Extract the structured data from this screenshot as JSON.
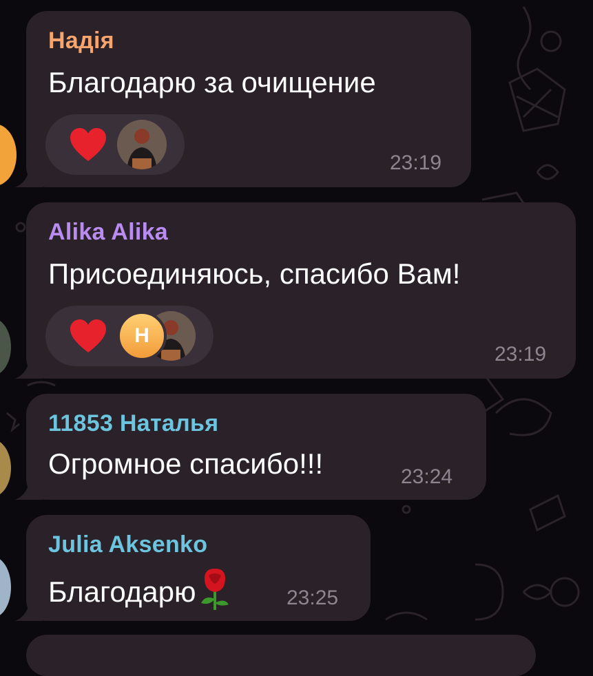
{
  "messages": [
    {
      "sender": "Надія",
      "sender_color": "#f5a56d",
      "text": "Благодарю за очищение",
      "time": "23:19",
      "reactions": {
        "emoji": "heart",
        "avatars": [
          "photo"
        ]
      }
    },
    {
      "sender": "Alika Alika",
      "sender_color": "#b88cf0",
      "text": "Присоединяюсь, спасибо Вам!",
      "time": "23:19",
      "reactions": {
        "emoji": "heart",
        "avatars": [
          "Н",
          "photo"
        ]
      }
    },
    {
      "sender": "11853 Наталья",
      "sender_color": "#6cc4de",
      "text": "Огромное спасибо!!!",
      "time": "23:24"
    },
    {
      "sender": "Julia Aksenko",
      "sender_color": "#6cc4de",
      "text": "Благодарю",
      "emoji": "rose",
      "time": "23:25"
    }
  ],
  "colors": {
    "background": "#0b090d",
    "bubble": "#2a2129",
    "reaction_pill": "#3a303a",
    "heart": "#e8222c",
    "time": "#8d8590"
  }
}
